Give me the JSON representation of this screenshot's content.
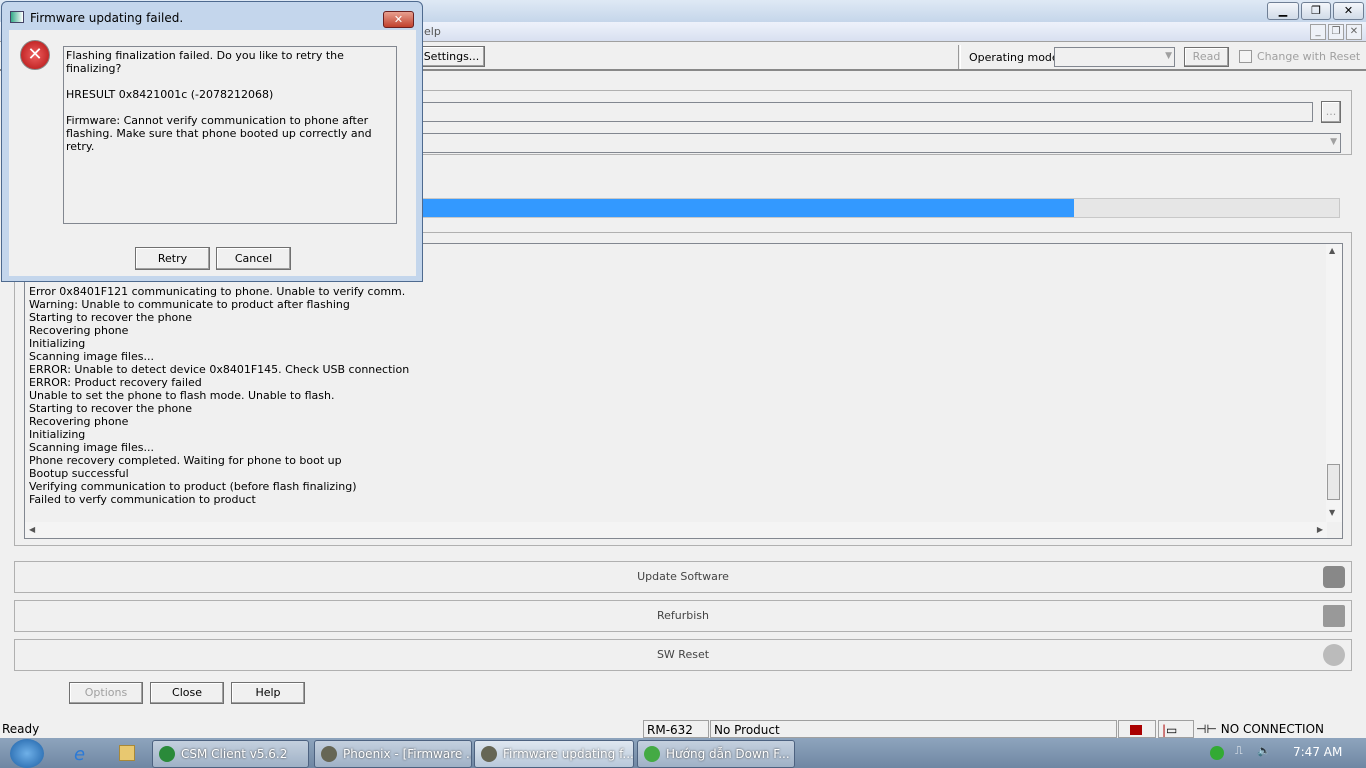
{
  "main_window": {
    "menu_partial": "elp",
    "toolbar": {
      "settings_label": "Settings...",
      "operating_mode_label": "Operating mode:",
      "operating_mode_value": "",
      "read_label": "Read",
      "change_with_reset_label": "Change with Reset",
      "change_with_reset_checked": false
    },
    "browse_label": "...",
    "progress_percent": 80,
    "progress_color": "#3399ff",
    "log_lines": [
      "Error 0x8401F121 communicating to phone. Unable to verify comm.",
      "Warning: Unable to communicate to product after flashing",
      "Starting to recover the phone",
      "Recovering phone",
      "Initializing",
      "Scanning image files...",
      "ERROR: Unable to detect device 0x8401F145. Check USB connection",
      "ERROR: Product recovery failed",
      "Unable to set the phone to flash mode. Unable to flash.",
      "Starting to recover the phone",
      "Recovering phone",
      "Initializing",
      "Scanning image files...",
      "Phone recovery completed. Waiting for phone to boot up",
      "Bootup successful",
      "Verifying communication to product (before flash finalizing)",
      "Failed to verfy communication to product"
    ],
    "actions": [
      {
        "label": "Update Software",
        "icon": "person-icon"
      },
      {
        "label": "Refurbish",
        "icon": "factory-icon"
      },
      {
        "label": "SW Reset",
        "icon": "reset-icon"
      }
    ],
    "bottom_buttons": {
      "options": "Options",
      "close": "Close",
      "help": "Help"
    },
    "statusbar": {
      "ready": "Ready",
      "product_code": "RM-632",
      "product": "No Product",
      "connection": "NO CONNECTION"
    }
  },
  "dialog": {
    "title": "Firmware updating failed.",
    "message1": "Flashing finalization failed. Do you like to retry the finalizing?",
    "message2": "HRESULT 0x8421001c (-2078212068)",
    "message3": "Firmware: Cannot verify communication to phone after flashing. Make sure that phone booted up correctly and retry.",
    "retry": "Retry",
    "cancel": "Cancel"
  },
  "taskbar": {
    "items": [
      "CSM Client v5.6.2",
      "Phoenix - [Firmware ...",
      "Firmware updating f...",
      "Hướng dẫn Down F..."
    ],
    "clock": "7:47 AM"
  }
}
